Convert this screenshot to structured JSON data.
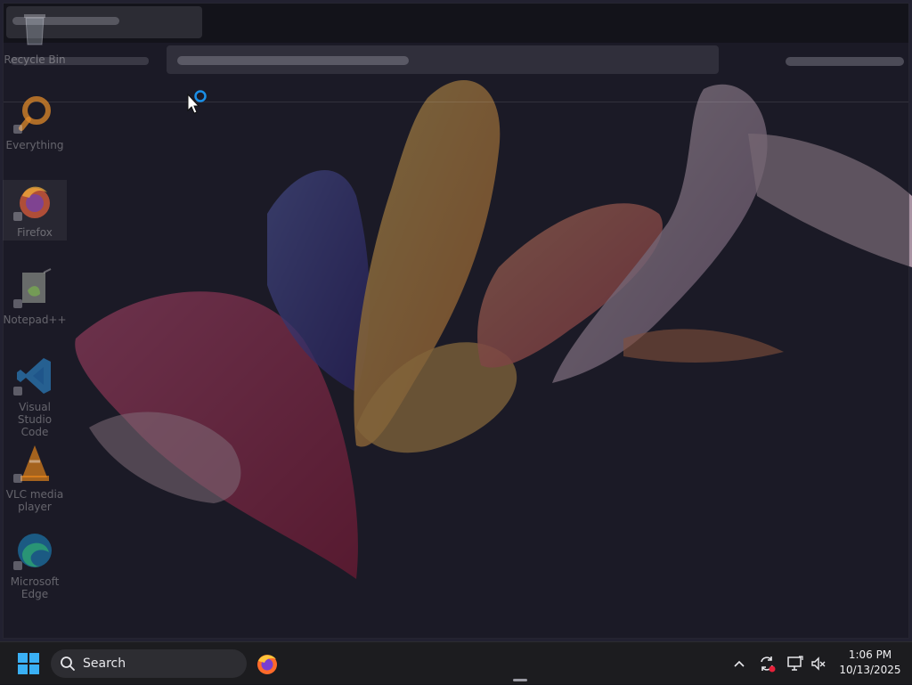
{
  "desktop": {
    "icons": [
      {
        "label": "Recycle Bin",
        "icon": "recycle-bin-icon"
      },
      {
        "label": "Everything",
        "icon": "everything-search-icon"
      },
      {
        "label": "Firefox",
        "icon": "firefox-icon"
      },
      {
        "label": "Notepad++",
        "icon": "notepad-plus-plus-icon"
      },
      {
        "label": "Visual Studio Code",
        "icon": "vscode-icon"
      },
      {
        "label": "VLC media player",
        "icon": "vlc-icon"
      },
      {
        "label": "Microsoft Edge",
        "icon": "edge-icon"
      }
    ]
  },
  "taskbar": {
    "search_label": "Search",
    "pinned": [
      {
        "name": "Firefox",
        "icon": "firefox-icon"
      }
    ],
    "tray_icons": [
      "chevron-up-icon",
      "sync-alert-icon",
      "network-icon",
      "speaker-muted-icon"
    ],
    "time": "1:06 PM",
    "date": "10/13/2025"
  },
  "colors": {
    "accent": "#0a84d8",
    "taskbar_bg": "#1c1c1f",
    "overlay": "#14141c"
  }
}
